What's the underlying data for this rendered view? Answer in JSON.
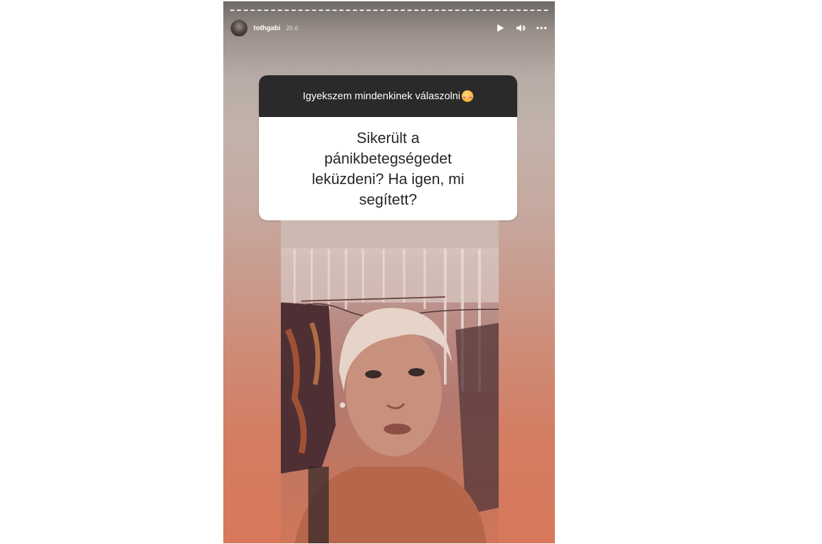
{
  "story": {
    "username": "tothgabi",
    "time_ago": "20 ó.",
    "controls": {
      "play_icon": "play-icon",
      "mute_icon": "volume-icon",
      "more_icon": "more-options-icon"
    },
    "question_box": {
      "header_text": "Igyekszem mindenkinek válaszolni",
      "header_emoji": "smiling-face-with-hearts",
      "question": "Sikerült a pánikbetegségedet leküzdeni? Ha igen, mi segített?"
    },
    "media": {
      "type": "video-frame"
    }
  }
}
